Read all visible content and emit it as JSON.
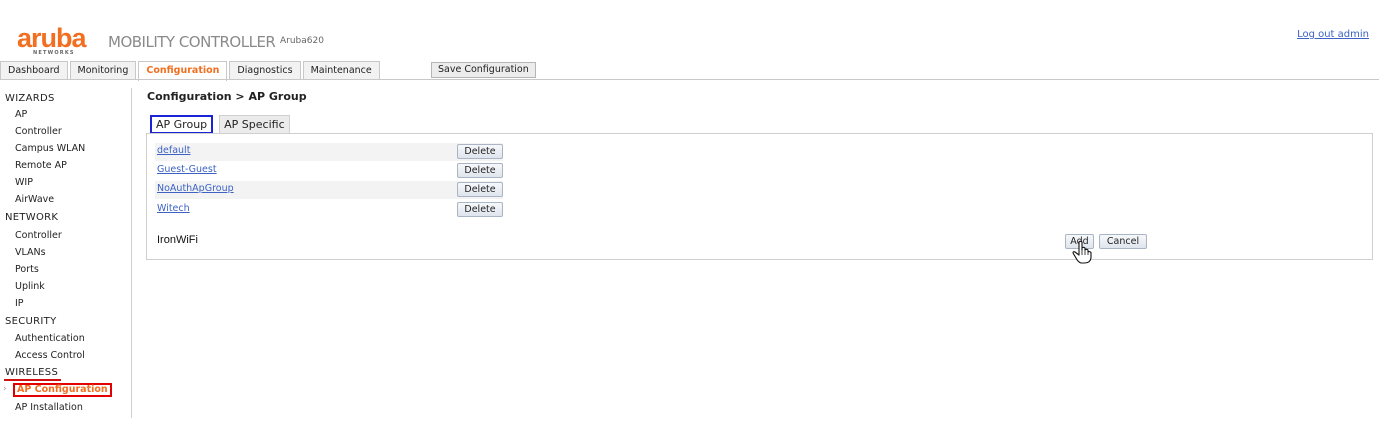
{
  "header": {
    "brand": "aruba",
    "brand_sub": "NETWORKS",
    "product": "MOBILITY CONTROLLER",
    "hostname": "Aruba620",
    "logout": "Log out admin"
  },
  "nav": {
    "tabs": [
      "Dashboard",
      "Monitoring",
      "Configuration",
      "Diagnostics",
      "Maintenance"
    ],
    "active": "Configuration",
    "save_config": "Save Configuration"
  },
  "sidebar": {
    "wizards": {
      "title": "WIZARDS",
      "items": [
        "AP",
        "Controller",
        "Campus WLAN",
        "Remote AP",
        "WIP",
        "AirWave"
      ]
    },
    "network": {
      "title": "NETWORK",
      "items": [
        "Controller",
        "VLANs",
        "Ports",
        "Uplink",
        "IP"
      ]
    },
    "security": {
      "title": "SECURITY",
      "items": [
        "Authentication",
        "Access Control"
      ]
    },
    "wireless": {
      "title": "WIRELESS",
      "items": [
        "AP Configuration",
        "AP Installation"
      ]
    },
    "active_item": "AP Configuration"
  },
  "main": {
    "title": "Configuration > AP Group",
    "tabs": [
      "AP Group",
      "AP Specific"
    ],
    "active_tab": "AP Group",
    "groups": [
      "default",
      "Guest-Guest",
      "NoAuthApGroup",
      "Witech"
    ],
    "delete_label": "Delete",
    "new_group_value": "IronWiFi",
    "add_label": "Add",
    "cancel_label": "Cancel"
  },
  "colors": {
    "accent_orange": "#f26f21",
    "link_blue": "#3b62c4",
    "highlight_red": "#e20000",
    "highlight_blue": "#1a24d6"
  }
}
